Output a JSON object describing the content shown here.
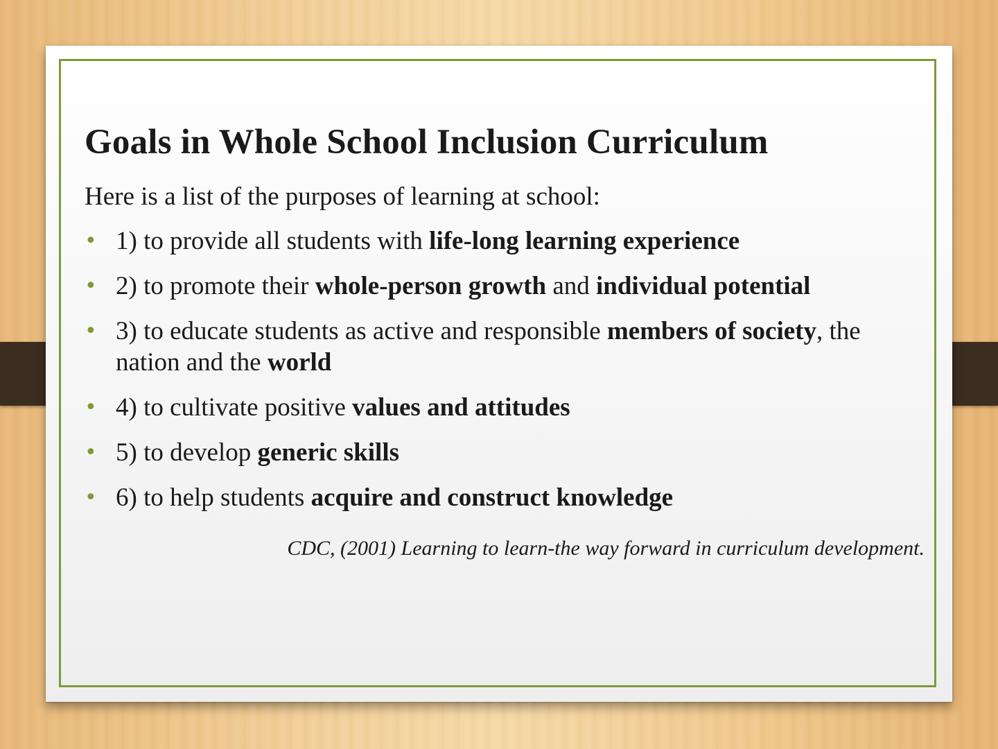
{
  "slide": {
    "title": "Goals in Whole School Inclusion Curriculum",
    "intro": "Here is a list of the purposes of learning at school:",
    "bullet_color": "#7e9a35",
    "goals": [
      {
        "segments": [
          {
            "text": "1) to provide all students with ",
            "bold": false
          },
          {
            "text": "life-long learning experience",
            "bold": true
          }
        ]
      },
      {
        "segments": [
          {
            "text": "2) to promote their ",
            "bold": false
          },
          {
            "text": "whole-person growth",
            "bold": true
          },
          {
            "text": " and ",
            "bold": false
          },
          {
            "text": "individual potential",
            "bold": true
          }
        ]
      },
      {
        "segments": [
          {
            "text": "3) to educate students as active and responsible ",
            "bold": false
          },
          {
            "text": "members of society",
            "bold": true
          },
          {
            "text": ", the nation and the ",
            "bold": false
          },
          {
            "text": "world",
            "bold": true
          }
        ]
      },
      {
        "segments": [
          {
            "text": "4) to cultivate positive ",
            "bold": false
          },
          {
            "text": "values and attitudes",
            "bold": true
          }
        ]
      },
      {
        "segments": [
          {
            "text": "5) to develop ",
            "bold": false
          },
          {
            "text": "generic skills",
            "bold": true
          }
        ]
      },
      {
        "segments": [
          {
            "text": "6) to help students ",
            "bold": false
          },
          {
            "text": "acquire and construct knowledge",
            "bold": true
          }
        ]
      }
    ],
    "citation": "CDC, (2001) Learning to learn-the way forward in curriculum development."
  }
}
